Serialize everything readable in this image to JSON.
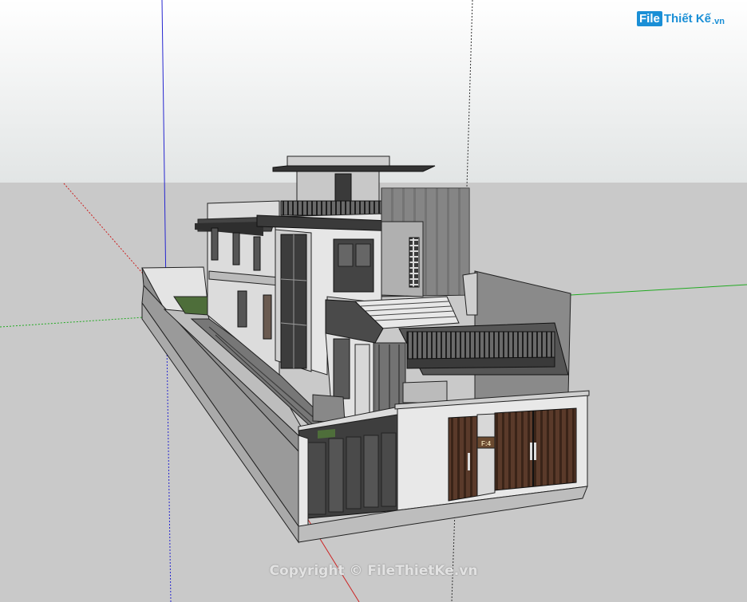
{
  "watermark": {
    "logo_prefix": "File",
    "logo_text": "Thiết Kế",
    "logo_suffix": ".vn",
    "copyright": "Copyright © FileThietKe.vn"
  },
  "plaque": "F:4",
  "colors": {
    "sky_top": "#ffffff",
    "sky_bottom": "#e4e6e6",
    "ground": "#c9c9c9",
    "axis_blue": "#2222cc",
    "axis_red": "#cc2222",
    "axis_green": "#22aa22",
    "accent_blue": "#1a8fd6"
  }
}
